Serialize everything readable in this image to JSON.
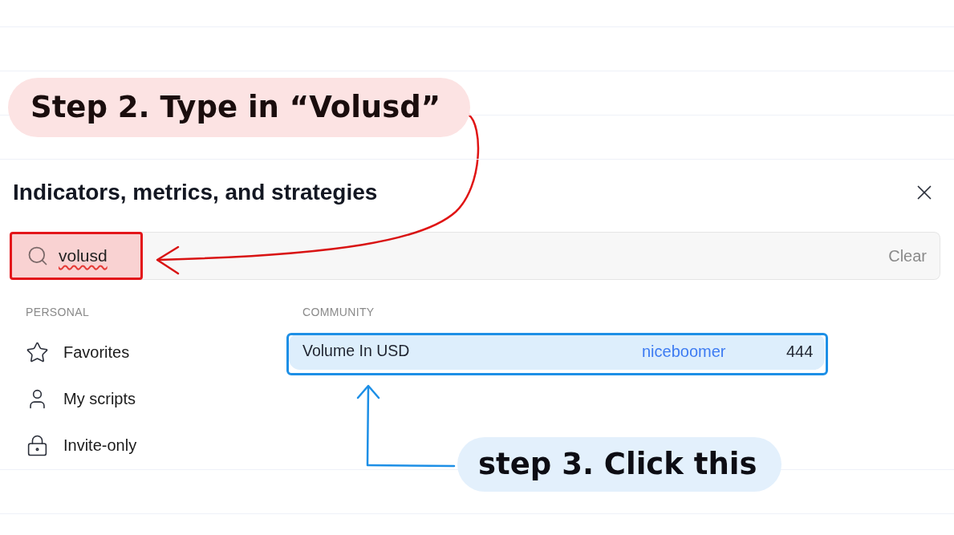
{
  "annotations": {
    "step_2": {
      "text": "Step 2. Type in “Volusd”"
    },
    "step_3": {
      "text": "step 3. Click this"
    }
  },
  "dialog": {
    "title": "Indicators, metrics, and strategies",
    "search": {
      "value": "volusd",
      "clear_label": "Clear"
    },
    "personal": {
      "heading": "PERSONAL",
      "items": [
        {
          "label": "Favorites",
          "selected": false
        },
        {
          "label": "My scripts",
          "selected": false
        },
        {
          "label": "Invite-only",
          "selected": false
        }
      ]
    },
    "community": {
      "heading": "COMMUNITY",
      "results": [
        {
          "title": "Volume In USD",
          "author": "niceboomer",
          "count": "444",
          "selected": true
        }
      ]
    }
  }
}
